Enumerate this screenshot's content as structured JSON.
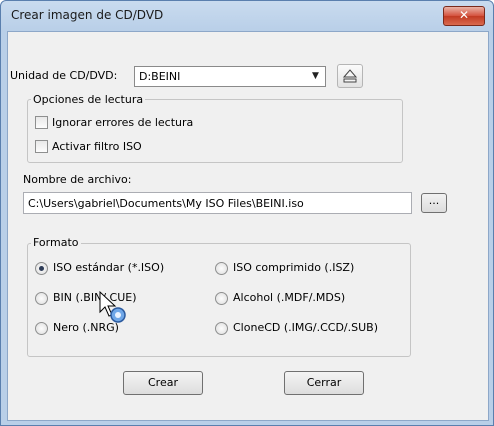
{
  "window": {
    "title": "Crear imagen de CD/DVD",
    "close_glyph": "✕"
  },
  "drive": {
    "label": "Unidad de CD/DVD:",
    "selected": "D:BEINI",
    "eject_icon": "eject-icon"
  },
  "read_options": {
    "legend": "Opciones de lectura",
    "ignore_errors": "Ignorar errores de lectura",
    "iso_filter": "Activar filtro ISO"
  },
  "file": {
    "label": "Nombre de archivo:",
    "path": "C:\\Users\\gabriel\\Documents\\My ISO Files\\BEINI.iso",
    "browse_label": "..."
  },
  "format": {
    "legend": "Formato",
    "options": [
      "ISO estándar (*.ISO)",
      "ISO comprimido (.ISZ)",
      "BIN (.BIN/.CUE)",
      "Alcohol (.MDF/.MDS)",
      "Nero (.NRG)",
      "CloneCD (.IMG/.CCD/.SUB)"
    ],
    "selected": "ISO estándar (*.ISO)"
  },
  "buttons": {
    "create": "Crear",
    "close": "Cerrar"
  }
}
